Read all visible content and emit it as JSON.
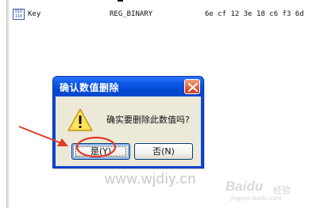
{
  "registry_row": {
    "icon": "binary-value-icon",
    "icon_bits": [
      "010",
      "110"
    ],
    "name": "Key",
    "type": "REG_BINARY",
    "data": "6e cf 12 3e 18 c6 f3 6d"
  },
  "dialog": {
    "title": "确认数值删除",
    "message": "确实要删除此数值吗?",
    "icon": "warning-icon",
    "close_icon": "close-icon",
    "buttons": {
      "yes": "是(Y)",
      "no": "否(N)"
    }
  },
  "annotations": {
    "arrow_color": "#e23a2a",
    "circle_color": "#e23a2a"
  },
  "watermarks": {
    "site": "www.wjdiy.cn",
    "baidu_logo": "Baidu",
    "baidu_suffix": "经验",
    "baidu_url": "jingyan.baidu.com"
  },
  "colors": {
    "titlebar": "#0a58e6",
    "dialog_body": "#ece9d8",
    "close_button": "#e0603a"
  }
}
